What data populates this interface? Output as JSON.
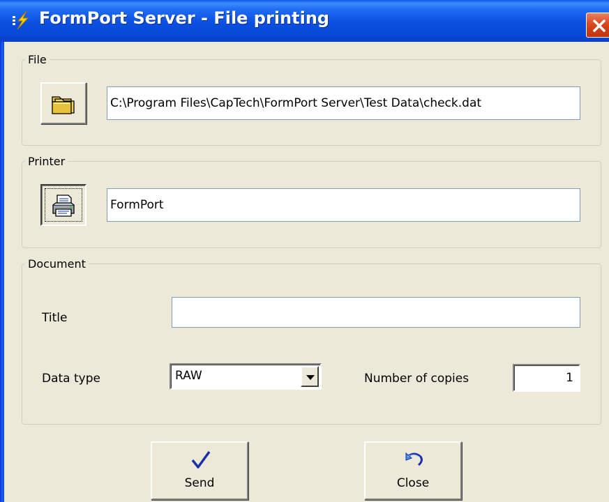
{
  "window": {
    "title": "FormPort Server - File printing",
    "icons": {
      "app": "app-lightning-icon",
      "close": "close-icon"
    },
    "colors": {
      "titlebar": "#0848d6",
      "close": "#d9481f",
      "face": "#ece9d8"
    }
  },
  "file_group": {
    "legend": "File",
    "browse_icon": "open-folder-icon",
    "path": "C:\\Program Files\\CapTech\\FormPort Server\\Test Data\\check.dat"
  },
  "printer_group": {
    "legend": "Printer",
    "printer_icon": "printer-icon",
    "printer_name": "FormPort"
  },
  "document_group": {
    "legend": "Document",
    "title_label": "Title",
    "title_value": "",
    "datatype_label": "Data type",
    "datatype_value": "RAW",
    "copies_label": "Number of copies",
    "copies_value": "1"
  },
  "buttons": {
    "send_label": "Send",
    "send_icon": "checkmark-icon",
    "close_label": "Close",
    "close_icon": "undo-arrow-icon"
  }
}
